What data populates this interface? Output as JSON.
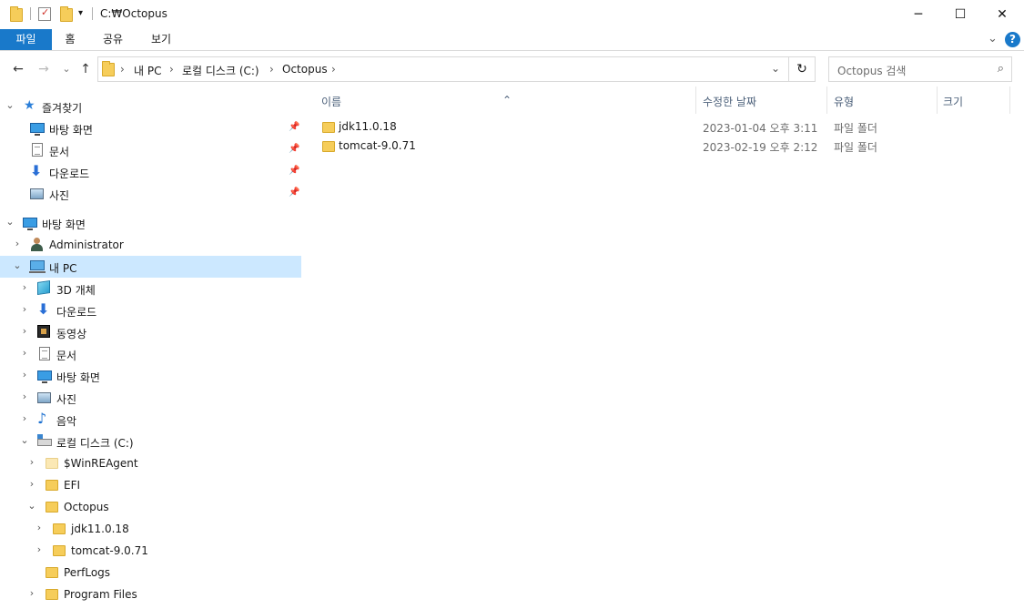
{
  "window": {
    "title": "C:₩Octopus",
    "minimize": "─",
    "maximize": "☐",
    "close": "✕"
  },
  "ribbon": {
    "tabs": [
      "파일",
      "홈",
      "공유",
      "보기"
    ],
    "collapse": "⌄",
    "help": "?"
  },
  "nav": {
    "back": "←",
    "forward": "→",
    "recent": "⌄",
    "up": "↑",
    "breadcrumb": [
      "내 PC",
      "로컬 디스크 (C:)",
      "Octopus"
    ],
    "sep": "›",
    "dropdown": "⌄",
    "refresh": "↻",
    "search_placeholder": "Octopus 검색"
  },
  "navpane": {
    "quick_access": {
      "label": "즐겨찾기",
      "items": [
        "바탕 화면",
        "문서",
        "다운로드",
        "사진"
      ]
    },
    "tree": {
      "desktop": "바탕 화면",
      "administrator": "Administrator",
      "this_pc": "내 PC",
      "pc_items": [
        "3D 개체",
        "다운로드",
        "동영상",
        "문서",
        "바탕 화면",
        "사진",
        "음악"
      ],
      "drive": "로컬 디스크 (C:)",
      "drive_items": [
        "$WinREAgent",
        "EFI",
        "Octopus"
      ],
      "octopus_items": [
        "jdk11.0.18",
        "tomcat-9.0.71"
      ],
      "more_items": [
        "PerfLogs",
        "Program Files"
      ]
    }
  },
  "content": {
    "columns": [
      "이름",
      "수정한 날짜",
      "유형",
      "크기"
    ],
    "rows": [
      {
        "name": "jdk11.0.18",
        "date": "2023-01-04 오후 3:11",
        "type": "파일 폴더"
      },
      {
        "name": "tomcat-9.0.71",
        "date": "2023-02-19 오후 2:12",
        "type": "파일 폴더"
      }
    ]
  }
}
